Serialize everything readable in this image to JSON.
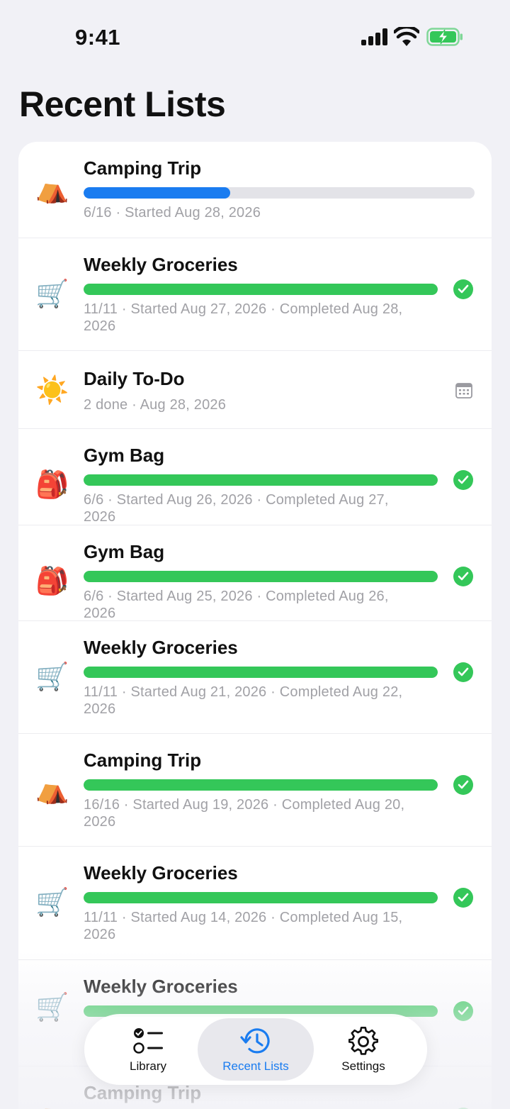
{
  "status_bar": {
    "time": "9:41"
  },
  "page_title": "Recent Lists",
  "colors": {
    "accent": "#1a7cf0",
    "done": "#34c759",
    "in_progress": "#1a7cf0",
    "track": "#e3e3e8"
  },
  "rows": [
    {
      "emoji": "⛺",
      "emoji_name": "tent-icon",
      "title": "Camping Trip",
      "progress": 0.375,
      "sub": "6/16 · Started Aug 28, 2026",
      "status": "in-progress"
    },
    {
      "emoji": "🛒",
      "emoji_name": "cart-icon",
      "title": "Weekly Groceries",
      "progress": 1.0,
      "sub": "11/11 · Started Aug 27, 2026 · Completed Aug 28, 2026",
      "status": "completed"
    },
    {
      "emoji": "☀️",
      "emoji_name": "sun-icon",
      "title": "Daily To-Do",
      "progress": null,
      "sub": "2 done · Aug 28, 2026",
      "status": "daily"
    },
    {
      "emoji": "🎒",
      "emoji_name": "backpack-icon",
      "title": "Gym Bag",
      "progress": 1.0,
      "sub": "6/6 · Started Aug 26, 2026 · Completed Aug 27, 2026",
      "status": "completed"
    },
    {
      "emoji": "🎒",
      "emoji_name": "backpack-icon",
      "title": "Gym Bag",
      "progress": 1.0,
      "sub": "6/6 · Started Aug 25, 2026 · Completed Aug 26, 2026",
      "status": "completed"
    },
    {
      "emoji": "🛒",
      "emoji_name": "cart-icon",
      "title": "Weekly Groceries",
      "progress": 1.0,
      "sub": "11/11 · Started Aug 21, 2026 · Completed Aug 22, 2026",
      "status": "completed"
    },
    {
      "emoji": "⛺",
      "emoji_name": "tent-icon",
      "title": "Camping Trip",
      "progress": 1.0,
      "sub": "16/16 · Started Aug 19, 2026 · Completed Aug 20, 2026",
      "status": "completed"
    },
    {
      "emoji": "🛒",
      "emoji_name": "cart-icon",
      "title": "Weekly Groceries",
      "progress": 1.0,
      "sub": "11/11 · Started Aug 14, 2026 · Completed Aug 15, 2026",
      "status": "completed"
    },
    {
      "emoji": "🛒",
      "emoji_name": "cart-icon",
      "title": "Weekly Groceries",
      "progress": 1.0,
      "sub": "",
      "status": "completed"
    },
    {
      "emoji": "⛺",
      "emoji_name": "tent-icon",
      "title": "Camping Trip",
      "progress": 1.0,
      "sub": "",
      "status": "completed"
    }
  ],
  "tabs": [
    {
      "label": "Library",
      "icon": "list-icon",
      "active": false
    },
    {
      "label": "Recent Lists",
      "icon": "history-icon",
      "active": true
    },
    {
      "label": "Settings",
      "icon": "gear-icon",
      "active": false
    }
  ]
}
